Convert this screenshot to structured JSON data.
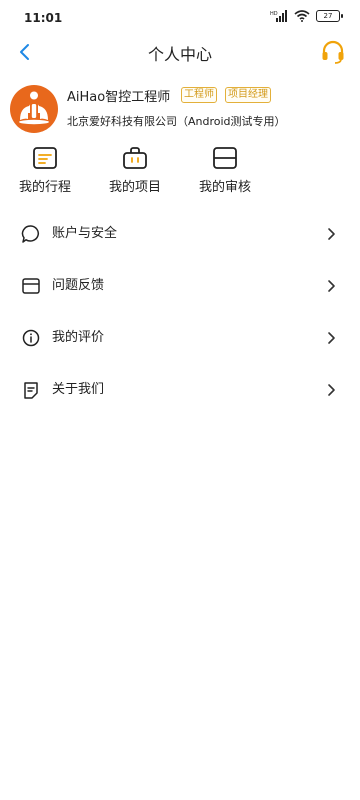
{
  "status_bar": {
    "time": "11:01",
    "battery": "27",
    "network": "HD"
  },
  "header": {
    "title": "个人中心"
  },
  "profile": {
    "name": "AiHao智控工程师",
    "tags": [
      "工程师",
      "项目经理"
    ],
    "company": "北京爱好科技有限公司（Android测试专用）"
  },
  "shortcuts": [
    {
      "label": "我的行程",
      "icon": "itinerary-icon"
    },
    {
      "label": "我的项目",
      "icon": "project-bag-icon"
    },
    {
      "label": "我的审核",
      "icon": "review-icon"
    }
  ],
  "menu": [
    {
      "label": "账户与安全",
      "icon": "chat-bubble-icon"
    },
    {
      "label": "问题反馈",
      "icon": "feedback-window-icon"
    },
    {
      "label": "我的评价",
      "icon": "info-circle-icon"
    },
    {
      "label": "关于我们",
      "icon": "document-icon"
    }
  ],
  "colors": {
    "accent_blue": "#1e88e5",
    "accent_orange": "#f0a30a",
    "avatar_orange": "#e8681c",
    "tag_gold": "#d39b1c"
  }
}
